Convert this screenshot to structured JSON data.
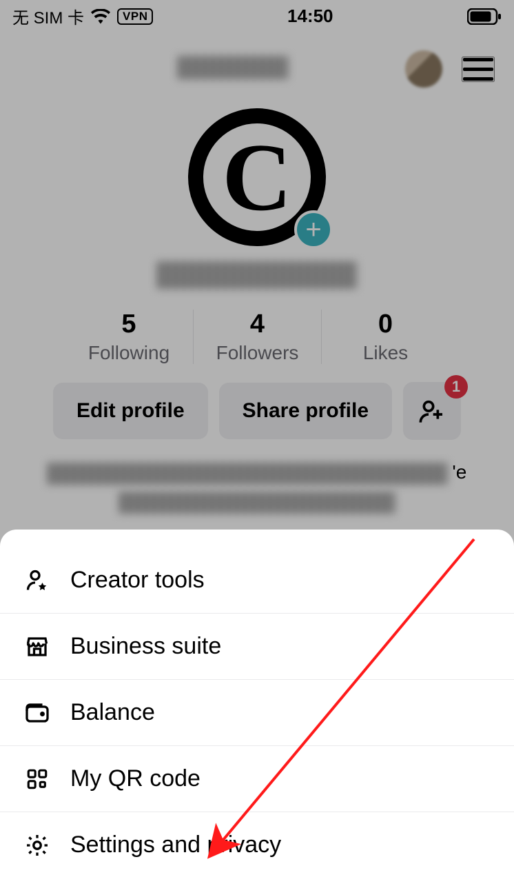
{
  "status": {
    "carrier": "无 SIM 卡",
    "vpn": "VPN",
    "time": "14:50"
  },
  "profile": {
    "avatar_letter": "C",
    "following_count": "5",
    "following_label": "Following",
    "followers_count": "4",
    "followers_label": "Followers",
    "likes_count": "0",
    "likes_label": "Likes",
    "edit_label": "Edit profile",
    "share_label": "Share profile",
    "add_friend_badge": "1"
  },
  "sheet": {
    "items": [
      {
        "label": "Creator tools"
      },
      {
        "label": "Business suite"
      },
      {
        "label": "Balance"
      },
      {
        "label": "My QR code"
      },
      {
        "label": "Settings and privacy"
      }
    ]
  }
}
